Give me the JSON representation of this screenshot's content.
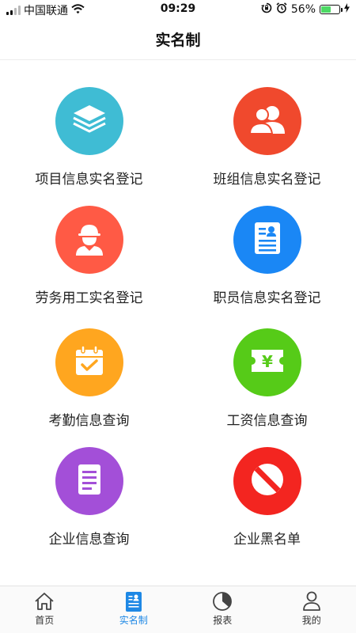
{
  "status_bar": {
    "carrier": "中国联通",
    "time": "09:29",
    "battery_percent": "56%",
    "battery_level": 0.56,
    "icons": [
      "signal-icon",
      "wifi-icon",
      "rotation-lock-icon",
      "alarm-icon",
      "battery-icon",
      "charging-icon"
    ]
  },
  "header": {
    "title": "实名制"
  },
  "grid": {
    "items": [
      {
        "label": "项目信息实名登记",
        "icon": "layers-icon",
        "color": "#3fbcd4"
      },
      {
        "label": "班组信息实名登记",
        "icon": "group-icon",
        "color": "#f0492d"
      },
      {
        "label": "劳务用工实名登记",
        "icon": "worker-icon",
        "color": "#ff5a45"
      },
      {
        "label": "职员信息实名登记",
        "icon": "id-card-icon",
        "color": "#1a87f5"
      },
      {
        "label": "考勤信息查询",
        "icon": "calendar-check-icon",
        "color": "#ffa61f"
      },
      {
        "label": "工资信息查询",
        "icon": "salary-ticket-icon",
        "color": "#56cb18"
      },
      {
        "label": "企业信息查询",
        "icon": "document-icon",
        "color": "#a34fd8"
      },
      {
        "label": "企业黑名单",
        "icon": "ban-icon",
        "color": "#f32520"
      }
    ]
  },
  "tab_bar": {
    "active_color": "#1e88e5",
    "items": [
      {
        "label": "首页",
        "icon": "home-icon"
      },
      {
        "label": "实名制",
        "icon": "realname-icon"
      },
      {
        "label": "报表",
        "icon": "report-icon"
      },
      {
        "label": "我的",
        "icon": "profile-icon"
      }
    ]
  }
}
